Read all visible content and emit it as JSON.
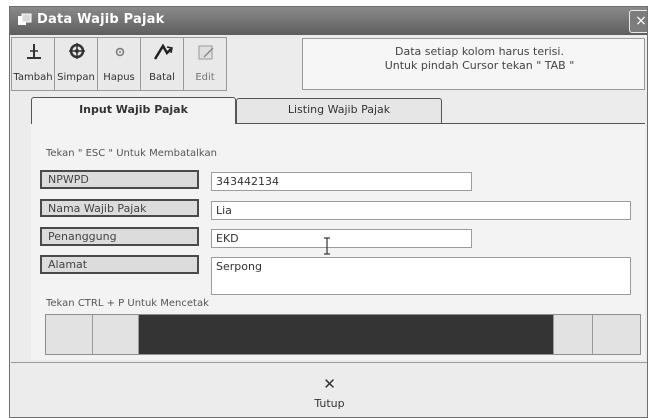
{
  "window": {
    "title": "Data Wajib Pajak",
    "close_label": "×"
  },
  "toolbar": {
    "buttons": [
      {
        "label": "Tambah",
        "icon": "plus-pin-icon"
      },
      {
        "label": "Simpan",
        "icon": "save-icon"
      },
      {
        "label": "Hapus",
        "icon": "delete-icon"
      },
      {
        "label": "Batal",
        "icon": "undo-icon"
      },
      {
        "label": "Edit",
        "icon": "edit-icon",
        "disabled": true
      }
    ]
  },
  "notice": {
    "line1": "Data setiap kolom harus terisi.",
    "line2": "Untuk pindah Cursor tekan \" TAB \""
  },
  "tabs": [
    {
      "label": "Input Wajib Pajak",
      "active": true
    },
    {
      "label": "Listing Wajib Pajak",
      "active": false
    }
  ],
  "form": {
    "esc_hint": "Tekan \" ESC \" Untuk Membatalkan",
    "fields": [
      {
        "label": "NPWPD",
        "value": "343442134"
      },
      {
        "label": "Nama Wajib Pajak",
        "value": "Lia"
      },
      {
        "label": "Penanggung",
        "value": "EKD"
      },
      {
        "label": "Alamat",
        "value": "Serpong"
      }
    ],
    "print_hint": "Tekan CTRL + P Untuk Mencetak"
  },
  "progress": {
    "fill_fraction": 0.67
  },
  "footer": {
    "close_label": "Tutup",
    "icon": "close-x-icon"
  }
}
